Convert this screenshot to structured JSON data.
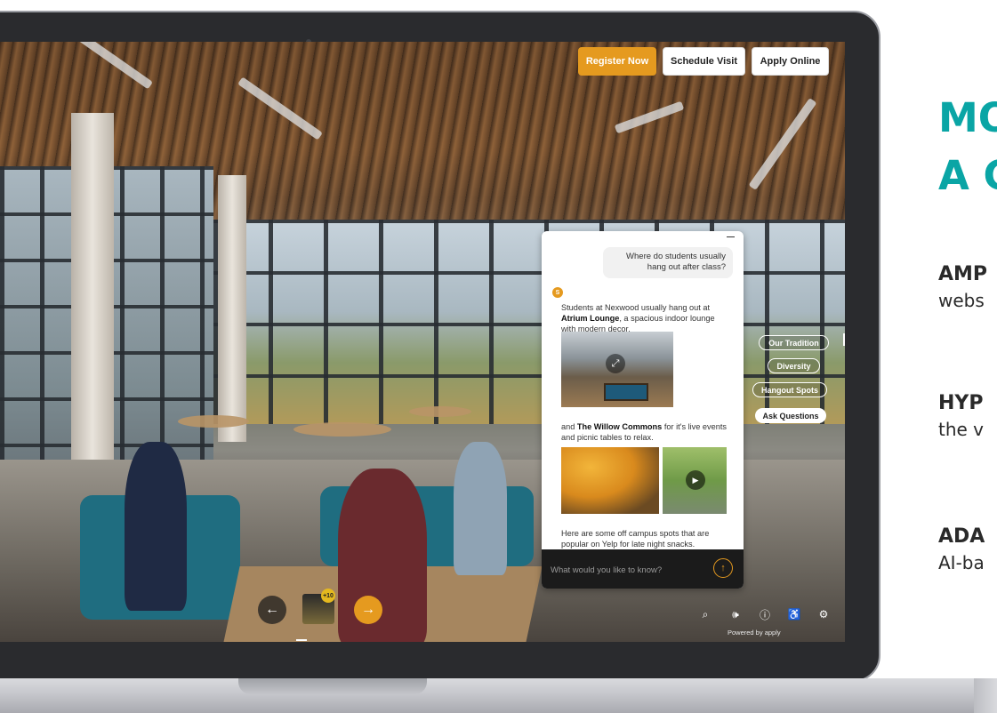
{
  "side": {
    "headline_line1": "MO",
    "headline_line2": "A C",
    "headline_color": "#0aa5a5",
    "features": [
      {
        "title": "AMP",
        "desc": "webs"
      },
      {
        "title": "HYP",
        "desc": "the v"
      },
      {
        "title": "ADA",
        "desc": "AI-ba"
      }
    ]
  },
  "tour": {
    "buttons": {
      "register": "Register Now",
      "schedule": "Schedule Visit",
      "apply": "Apply Online"
    },
    "chat": {
      "user_message": "Where do students usually hang out after class?",
      "bot_avatar_letter": "S",
      "bot_intro_prefix": "Students at Nexwood usually hang out at ",
      "bot_intro_bold": "Atrium Lounge",
      "bot_intro_suffix": ", a spacious indoor lounge with modern decor.",
      "bot_second_prefix": "and ",
      "bot_second_bold": "The Willow Commons",
      "bot_second_suffix": " for it's live events and picnic tables to relax.",
      "bot_third": "Here are some off campus spots that are popular on Yelp for late night snacks.",
      "input_placeholder": "What would you like to know?",
      "send_icon": "arrow-up-icon",
      "expand_icon": "expand-icon",
      "play_icon": "play-icon"
    },
    "topics": [
      "Our Tradition",
      "Diversity",
      "Hangout Spots",
      "Ask Questions"
    ],
    "nav": {
      "prev_icon": "arrow-left-icon",
      "next_icon": "arrow-right-icon",
      "thumb_badge": "+10"
    },
    "toolbar_icons": [
      "search-icon",
      "volume-icon",
      "info-icon",
      "accessibility-icon",
      "settings-icon"
    ],
    "powered_by": "Powered by",
    "brand": "applу"
  },
  "colors": {
    "accent_orange": "#e59a1f",
    "teal": "#0aa5a5",
    "chat_input_bg": "#1b1b1b"
  }
}
